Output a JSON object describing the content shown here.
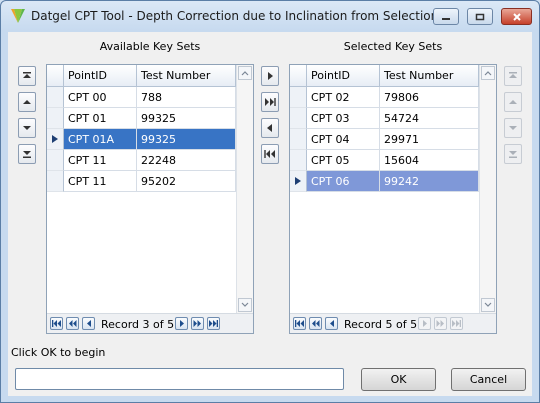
{
  "window": {
    "title": "Datgel CPT Tool - Depth Correction due to Inclination from Selection",
    "controls": [
      "minimize-icon",
      "maximize-icon",
      "close-icon"
    ]
  },
  "available": {
    "title": "Available Key Sets",
    "columns": [
      "PointID",
      "Test Number"
    ],
    "rows": [
      {
        "point": "CPT 00",
        "test": "788"
      },
      {
        "point": "CPT 01",
        "test": "99325"
      },
      {
        "point": "CPT 01A",
        "test": "99325"
      },
      {
        "point": "CPT 11",
        "test": "22248"
      },
      {
        "point": "CPT 11",
        "test": "95202"
      }
    ],
    "selected_row": 3,
    "record_text": "Record 3 of 5"
  },
  "selected": {
    "title": "Selected Key Sets",
    "columns": [
      "PointID",
      "Test Number"
    ],
    "rows": [
      {
        "point": "CPT 02",
        "test": "79806"
      },
      {
        "point": "CPT 03",
        "test": "54724"
      },
      {
        "point": "CPT 04",
        "test": "29971"
      },
      {
        "point": "CPT 05",
        "test": "15604"
      },
      {
        "point": "CPT 06",
        "test": "99242"
      }
    ],
    "selected_row": 5,
    "record_text": "Record 5 of 5"
  },
  "footer": {
    "instruction": "Click OK to begin",
    "ok_label": "OK",
    "cancel_label": "Cancel"
  },
  "colors": {
    "row_selected_focus": "#3874c5",
    "row_selected_nofocus": "#7f98d8"
  }
}
